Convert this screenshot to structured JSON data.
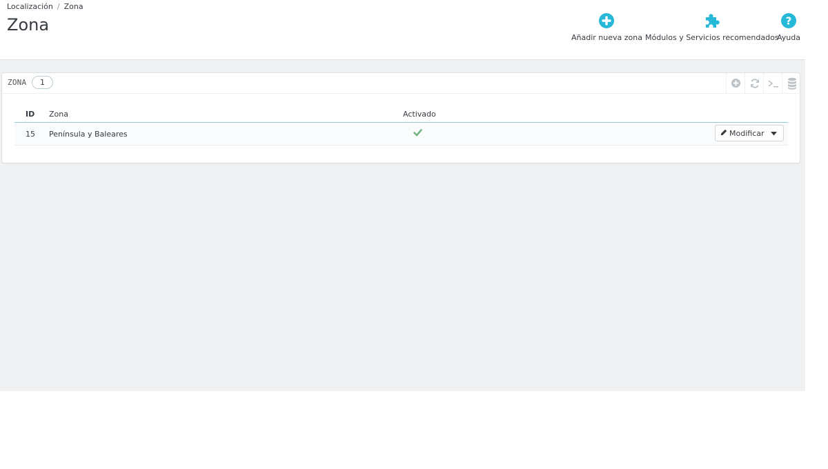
{
  "breadcrumb": {
    "parent": "Localización",
    "separator": "/",
    "current": "Zona"
  },
  "page_title": "Zona",
  "toolbar": {
    "add_label": "Añadir nueva zona",
    "modules_label": "Módulos y Servicios recomendados",
    "help_label": "Ayuda",
    "icons": {
      "add": "plus-circle-icon",
      "modules": "puzzle-icon",
      "help": "question-circle-icon"
    }
  },
  "panel": {
    "title": "ZONA",
    "count": "1",
    "tools": [
      "add-icon",
      "refresh-icon",
      "sql-terminal-icon",
      "database-icon"
    ]
  },
  "table": {
    "headers": {
      "id": "ID",
      "zone": "Zona",
      "active": "Activado"
    },
    "rows": [
      {
        "id": "15",
        "zone": "Península y Baleares",
        "active": true,
        "action": "Modificar"
      }
    ]
  },
  "colors": {
    "accent": "#25b9d7",
    "success": "#70b580",
    "text": "#363a41",
    "background": "#eff1f2"
  }
}
